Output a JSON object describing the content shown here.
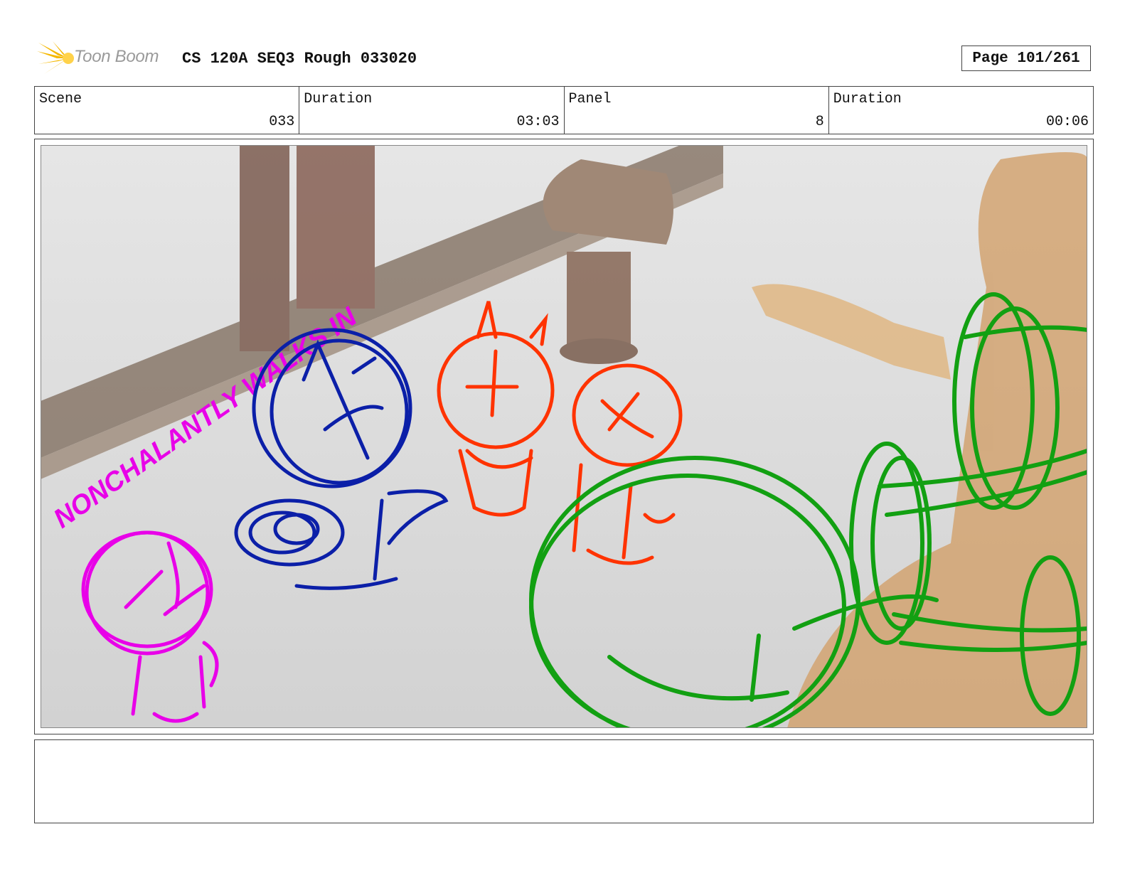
{
  "header": {
    "brand": "Toon Boom",
    "title": "CS 120A SEQ3 Rough 033020",
    "page": "Page 101/261"
  },
  "info": {
    "scene_label": "Scene",
    "scene_value": "033",
    "duration_label": "Duration",
    "duration_value": "03:03",
    "panel_label": "Panel",
    "panel_value": "8",
    "panel_duration_label": "Duration",
    "panel_duration_value": "00:06"
  },
  "panel": {
    "annotation": "NONCHALANTLY WALKS IN",
    "colors": {
      "magenta": "#e800e8",
      "blue": "#0b1fa8",
      "red": "#ff3300",
      "green": "#12a012"
    }
  },
  "notes": {
    "text": ""
  }
}
